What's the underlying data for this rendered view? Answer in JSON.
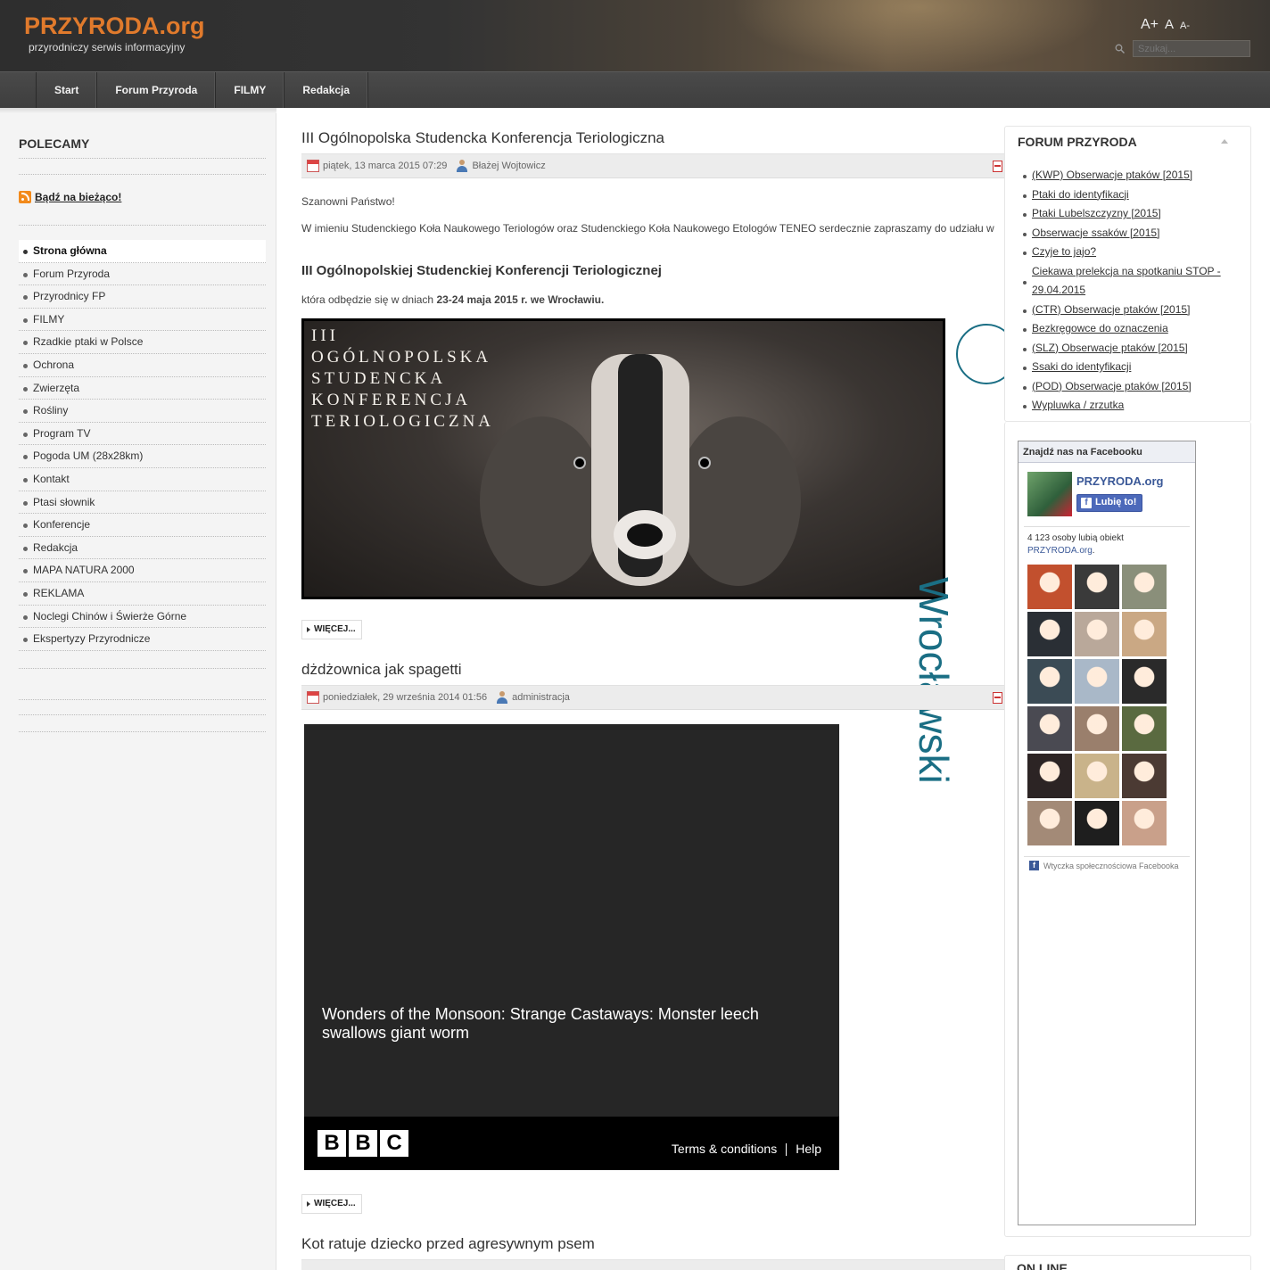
{
  "header": {
    "logo": "PRZYRODA.org",
    "slogan": "przyrodniczy serwis informacyjny",
    "font_bigger": "A+",
    "font_reset": "A",
    "font_smaller": "A-",
    "search_placeholder": "Szukaj...",
    "search_icon": "search-icon"
  },
  "nav": {
    "items": [
      "Start",
      "Forum Przyroda",
      "FILMY",
      "Redakcja"
    ]
  },
  "left": {
    "title": "POLECAMY",
    "rss_label": "Bądź na bieżąco!",
    "menu": [
      "Strona główna",
      "Forum Przyroda",
      "Przyrodnicy FP",
      "FILMY",
      "Rzadkie ptaki w Polsce",
      "Ochrona",
      "Zwierzęta",
      "Rośliny",
      "Program TV",
      "Pogoda UM (28x28km)",
      "Kontakt",
      "Ptasi słownik",
      "Konferencje",
      "Redakcja",
      "MAPA NATURA 2000",
      "REKLAMA",
      "Noclegi Chinów i Świerże Górne",
      "Ekspertyzy Przyrodnicze"
    ]
  },
  "articles": [
    {
      "title": "III Ogólnopolska Studencka Konferencja Teriologiczna",
      "date": "piątek, 13 marca 2015 07:29",
      "author": "Błażej Wojtowicz",
      "greeting": "Szanowni Państwo!",
      "intro": "W imieniu Studenckiego Koła Naukowego Teriologów oraz Studenckiego Koła Naukowego Etologów TENEO serdecznie zapraszamy do udziału w",
      "heading": "III Ogólnopolskiej Studenckiej Konferencji Teriologicznej",
      "date_prefix": "która odbędzie się w dniach ",
      "date_bold": "23-24 maja 2015 r. we Wrocławiu.",
      "banner_text": "III\nOGÓLNOPOLSKA\nSTUDENCKA\nKONFERENCJA\nTERIOLOGICZNA",
      "uni_text": "Wrocławski",
      "more": "WIĘCEJ..."
    },
    {
      "title": "dżdżownica jak spagetti",
      "date": "poniedziałek, 29 września 2014 01:56",
      "author": "administracja",
      "video_title": "Wonders of the Monsoon: Strange Castaways: Monster leech swallows giant worm",
      "video_brand": [
        "B",
        "B",
        "C"
      ],
      "video_terms": "Terms & conditions",
      "video_help": "Help",
      "more": "WIĘCEJ..."
    },
    {
      "title": "Kot ratuje dziecko przed agresywnym psem"
    }
  ],
  "right": {
    "forum_title": "FORUM PRZYRODA",
    "forum_items": [
      "(KWP) Obserwacje ptaków [2015]",
      "Ptaki do identyfikacji",
      "Ptaki Lubelszczyzny [2015]",
      "Obserwacje ssaków [2015]",
      "Czyje to jajo?",
      "Ciekawa prelekcja na spotkaniu STOP - 29.04.2015",
      "(CTR) Obserwacje ptaków [2015]",
      "Bezkręgowce do oznaczenia",
      "(SLZ) Obserwacje ptaków [2015]",
      "Ssaki do identyfikacji",
      "(POD) Obserwacje ptaków [2015]",
      "Wypluwka / zrzutka"
    ],
    "fb_header": "Znajdź nas na Facebooku",
    "fb_page": "PRZYRODA.org",
    "fb_like": "Lubię to!",
    "fb_count": "4 123 osoby lubią obiekt",
    "fb_count_link": "PRZYRODA.org",
    "fb_plugin": "Wtyczka społecznościowa Facebooka",
    "fb_faces": [
      "#c2502e",
      "#3a3a3a",
      "#8a8f7a",
      "#2a2f35",
      "#b9a89a",
      "#caa884",
      "#3b4b55",
      "#a9b8c8",
      "#2a2a2a",
      "#4a4a52",
      "#9a7f6c",
      "#5a6a40",
      "#2c2424",
      "#c9b38a",
      "#4b3a33",
      "#a38a77",
      "#1e1e1e",
      "#c9a08a"
    ],
    "online_title": "ON LINE"
  }
}
